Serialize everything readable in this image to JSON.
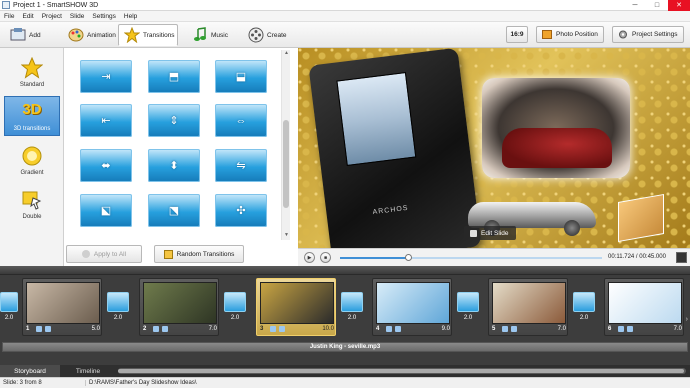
{
  "window": {
    "title": "Project 1 - SmartSHOW 3D",
    "minimize": "─",
    "maximize": "□",
    "close": "✕"
  },
  "menu": [
    "File",
    "Edit",
    "Project",
    "Slide",
    "Settings",
    "Help"
  ],
  "toolbar": {
    "tabs": [
      {
        "label": "Add",
        "icon": "add-icon"
      },
      {
        "label": "Animation",
        "icon": "palette-icon"
      },
      {
        "label": "Transitions",
        "icon": "star-icon",
        "active": true
      },
      {
        "label": "Music",
        "icon": "music-note-icon"
      },
      {
        "label": "Create",
        "icon": "film-reel-icon"
      }
    ],
    "aspect_label": "16:9",
    "photo_position_label": "Photo Position",
    "project_settings_label": "Project Settings"
  },
  "categories": [
    {
      "label": "Standard",
      "icon": "star-icon"
    },
    {
      "label": "3D transitions",
      "icon": "3d-icon",
      "selected": true
    },
    {
      "label": "Gradient",
      "icon": "gradient-icon"
    },
    {
      "label": "Double",
      "icon": "double-icon"
    }
  ],
  "category_3d_glyph": "3D",
  "transition_glyphs": [
    "⇥",
    "⬒",
    "⬓",
    "⇤",
    "⇕",
    "⇔",
    "⬌",
    "⬍",
    "⇋",
    "⬕",
    "⬔",
    "✣"
  ],
  "buttons": {
    "apply_to_all": "Apply to All",
    "random_transitions": "Random Transitions"
  },
  "preview": {
    "edit_slide_label": "Edit Slide",
    "device_brand": "ARCHOS"
  },
  "player": {
    "time": "00:11.724 / 00:45.000",
    "progress_fraction": 0.261
  },
  "slides": [
    {
      "num": "1",
      "duration": "5.0",
      "thumb_colors": [
        "#c8b8a6",
        "#6b5d4e"
      ]
    },
    {
      "num": "2",
      "duration": "7.0",
      "thumb_colors": [
        "#6f7b4c",
        "#2e3524"
      ]
    },
    {
      "num": "3",
      "duration": "10.0",
      "thumb_colors": [
        "#c9a543",
        "#2b2b2b"
      ],
      "selected": true
    },
    {
      "num": "4",
      "duration": "9.0",
      "thumb_colors": [
        "#d8ecf8",
        "#5fa6d8"
      ]
    },
    {
      "num": "5",
      "duration": "7.0",
      "thumb_colors": [
        "#e4dcc8",
        "#8b5a3a"
      ]
    },
    {
      "num": "6",
      "duration": "7.0",
      "thumb_colors": [
        "#ffffff",
        "#bcdaf0"
      ]
    }
  ],
  "transitions": [
    "2.0",
    "2.0",
    "2.0",
    "2.0",
    "2.0",
    "2.0"
  ],
  "audio_track": "Justin King - seville.mp3",
  "bottom_tabs": [
    "Storyboard",
    "Timeline"
  ],
  "status": {
    "slide_info": "Slide: 3 from 8",
    "path": "D:\\RAMS\\Father's Day Slideshow Ideas\\"
  }
}
